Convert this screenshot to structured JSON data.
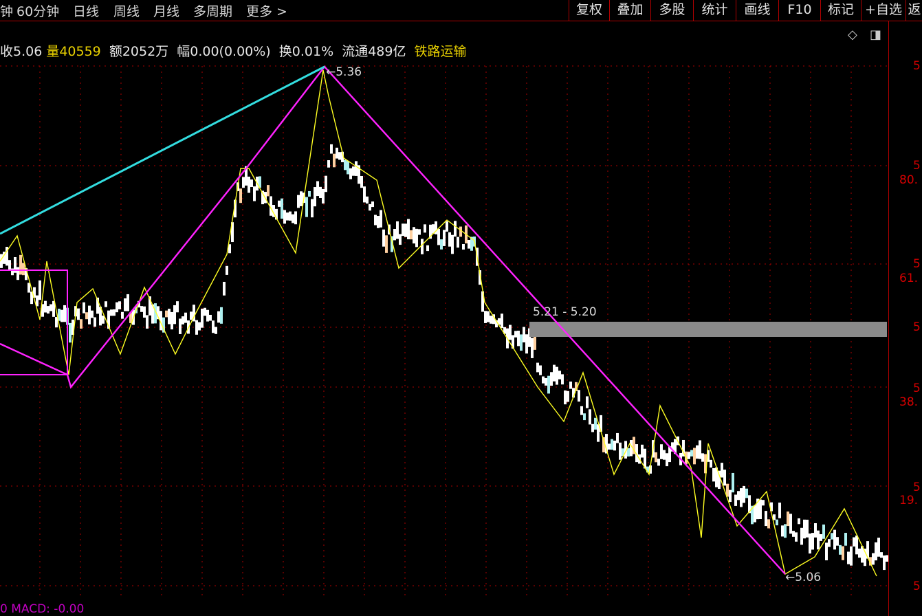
{
  "topbar": {
    "periods": [
      "钟",
      "60分钟",
      "日线",
      "周线",
      "月线",
      "多周期",
      "更多 >"
    ],
    "tools": [
      "复权",
      "叠加",
      "多股",
      "统计",
      "画线",
      "F10",
      "标记",
      "+自选",
      "返"
    ]
  },
  "info": {
    "close_label": "收5.06",
    "volume_prefix": "量",
    "volume_value": "40559",
    "amount": "额2052万",
    "change": "幅0.00(0.00%)",
    "turnover": "换0.01%",
    "float": "流通489亿",
    "sector": "铁路运输"
  },
  "chart": {
    "high_label": "←5.36",
    "low_label": "←5.06",
    "zone_label": "5.21 - 5.20",
    "macd_label": "0  MACD: -0.00",
    "right_axis": [
      "5",
      "5",
      "80.",
      "5",
      "61.",
      "5",
      "5",
      "38.",
      "5",
      "19.",
      "5"
    ],
    "colors": {
      "trendline": "#ff22ff",
      "channel": "#33dde0",
      "zigzag": "#ffff22",
      "grid": "#b00000",
      "zone": "#8a8a8a"
    }
  },
  "icons": {
    "diamond": "◇",
    "panel": "◨"
  }
}
